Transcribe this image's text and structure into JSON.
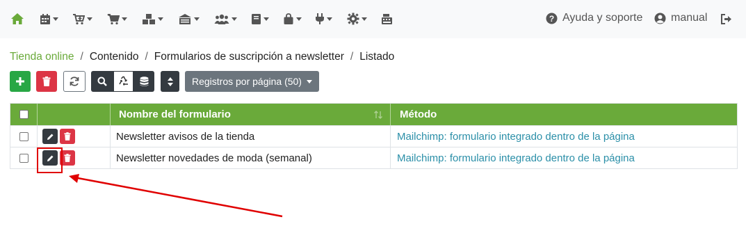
{
  "navbar": {
    "icons": [
      "home-icon",
      "calendar-icon",
      "cart-add-icon",
      "cart-icon",
      "warehouse-icon",
      "store-icon",
      "users-icon",
      "book-icon",
      "bag-icon",
      "plug-icon",
      "gear-icon",
      "register-icon"
    ],
    "help_label": "Ayuda y soporte",
    "user_label": "manual"
  },
  "breadcrumb": {
    "items": [
      "Tienda online",
      "Contenido",
      "Formularios de suscripción a newsletter",
      "Listado"
    ],
    "separator": "/"
  },
  "toolbar": {
    "per_page_label": "Registros por página (50)"
  },
  "table": {
    "columns": [
      "",
      "",
      "Nombre del formulario",
      "Método"
    ],
    "rows": [
      {
        "name": "Newsletter avisos de la tienda",
        "method": "Mailchimp: formulario integrado dentro de la página"
      },
      {
        "name": "Newsletter novedades de moda (semanal)",
        "method": "Mailchimp: formulario integrado dentro de la página"
      }
    ]
  },
  "colors": {
    "accent_green": "#6aaa3a",
    "add_green": "#28a745",
    "delete_red": "#dc3545",
    "dark": "#343a40",
    "link_teal": "#2b8fa8",
    "annotation_red": "#e00000"
  }
}
